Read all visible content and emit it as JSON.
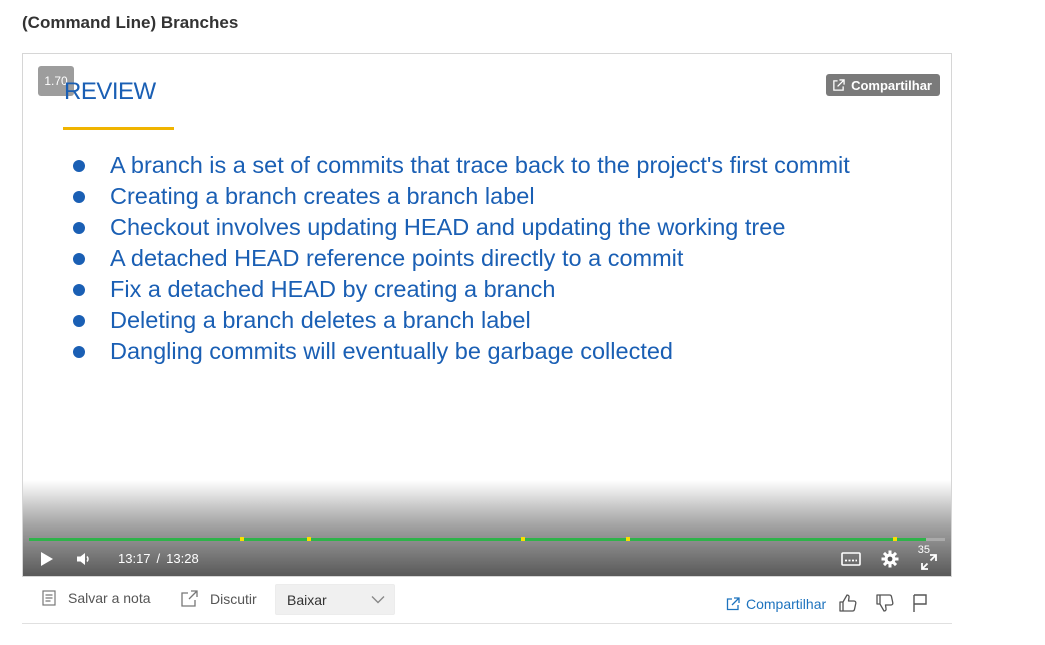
{
  "page": {
    "title": "(Command Line) Branches"
  },
  "player": {
    "speed": "1.70",
    "share_overlay_label": "Compartilhar",
    "slide": {
      "heading": "REVIEW",
      "bullets": [
        "A branch is a set of commits that trace back to the project's first commit",
        "Creating a branch creates a branch label",
        "Checkout involves updating HEAD and updating the working tree",
        "A detached HEAD reference points directly to a commit",
        "Fix a detached HEAD by creating a branch",
        "Deleting a branch deletes a branch label",
        "Dangling commits will eventually be garbage collected"
      ]
    },
    "controls": {
      "current_time": "13:17",
      "separator": "/",
      "duration": "13:28",
      "buffer_label": "35",
      "played_fraction": 0.979,
      "marker_fractions": [
        0.232,
        0.306,
        0.539,
        0.654,
        0.945
      ],
      "icons": [
        "play-icon",
        "volume-icon",
        "captions-icon",
        "gear-icon",
        "fullscreen-icon"
      ]
    }
  },
  "toolbar": {
    "save_note_label": "Salvar a nota",
    "discuss_label": "Discutir",
    "download_select": {
      "selected": "Baixar"
    },
    "share_label": "Compartilhar",
    "icons": [
      "note-icon",
      "discuss-icon",
      "chevron-down-icon",
      "share-icon",
      "thumbs-up-icon",
      "thumbs-down-icon",
      "flag-icon"
    ]
  },
  "colors": {
    "slide_text": "#1a5fb4",
    "slide_underline": "#f0b400",
    "progress_played": "#2fb34a",
    "progress_marker": "#f7e000",
    "link": "#1e73be"
  }
}
